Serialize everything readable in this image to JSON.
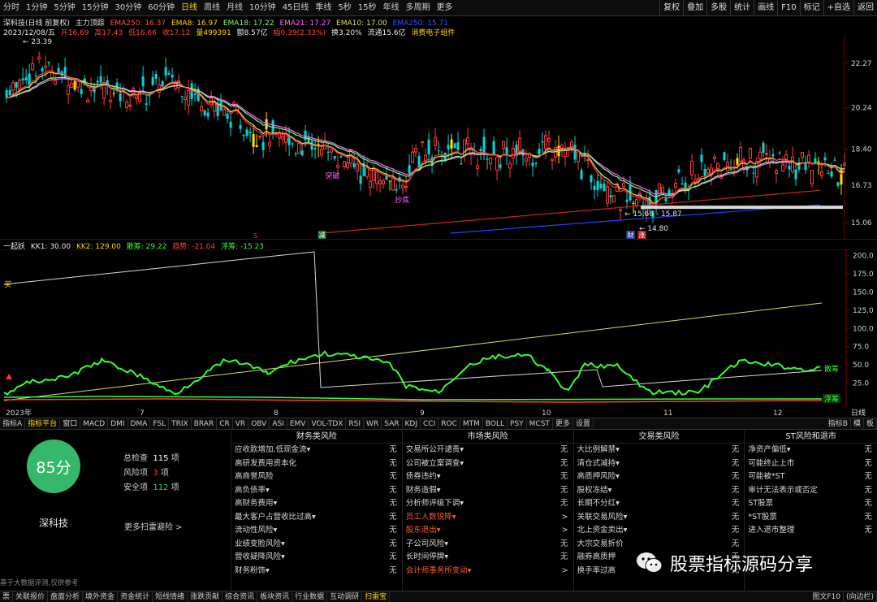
{
  "toolbar": {
    "periods": [
      "分时",
      "1分钟",
      "5分钟",
      "15分钟",
      "30分钟",
      "60分钟",
      "日线",
      "周线",
      "月线",
      "10分钟",
      "45日线",
      "季线",
      "5秒",
      "15秒",
      "年线",
      "多周期",
      "更多"
    ],
    "active_period": "日线",
    "right_buttons": [
      "复权",
      "叠加",
      "多股",
      "统计",
      "画线",
      "F10",
      "标记",
      "+自选",
      "返回"
    ]
  },
  "header": {
    "stock_name": "深科技(日线 前复权)",
    "indicator": "主力顶踪",
    "ema250": "EMA250: 16.37",
    "ema8": "EMA8: 16.97",
    "ema18": "EMA18: 17.22",
    "ema21": "EMA21: 17.27",
    "ema10": "EMA10: 17.00",
    "ema_hidden": "EMA250: 15.71",
    "date": "2023/12/08/五",
    "open": "开16.69",
    "high": "高17.43",
    "low": "低16.66",
    "close": "收17.12",
    "volume": "量499391",
    "amount": "额8.57亿",
    "change": "幅0.39(2.33%)",
    "turnover": "换3.20%",
    "float_cap": "流通15.6亿",
    "concept": "消费电子组件"
  },
  "price_axis": [
    "22.27",
    "20.24",
    "18.40",
    "16.73",
    "15.06"
  ],
  "price_marks": {
    "high": "23.39",
    "low": "14.80",
    "range": "15.66 - 15.87",
    "signal_buy": "抄底",
    "signal_break": "突破",
    "tag_reduce": "减",
    "tag_cai": "财",
    "tag_zhang": "涨",
    "tag_s": "S"
  },
  "indicator_header": {
    "name": "一起妖",
    "kk1": "KK1: 30.00",
    "kk2": "KK2: 129.00",
    "sanhu": "散筹: 29.22",
    "trend": "趋势: -21.04",
    "float": "浮筹: -15.23"
  },
  "indicator_axis": [
    "200.0",
    "175.0",
    "150.0",
    "125.0",
    "100.0",
    "75.0",
    "50.0",
    "25.0"
  ],
  "indicator_tags": {
    "buy": "买",
    "sanhu": "散筹",
    "float": "浮筹"
  },
  "time_axis": [
    "2023年",
    "7",
    "8",
    "9",
    "10",
    "11",
    "12"
  ],
  "time_axis_right": "日线",
  "tabs": [
    "指标A",
    "指标平台",
    "窗口",
    "MACD",
    "DMI",
    "DMA",
    "FSL",
    "TRIX",
    "BRAR",
    "CR",
    "VR",
    "OBV",
    "ASI",
    "EMV",
    "VOL-TDX",
    "RSI",
    "WR",
    "SAR",
    "KDJ",
    "CCI",
    "ROC",
    "MTM",
    "BOLL",
    "PSY",
    "MCST",
    "更多",
    "设置"
  ],
  "active_tab": "指标平台",
  "tabs_right": [
    "指标B",
    "模",
    "板"
  ],
  "risk": {
    "score": "85分",
    "stock": "深科技",
    "total_label": "总检查",
    "total_value": "115",
    "risk_label": "风险项",
    "risk_value": "3",
    "safe_label": "安全项",
    "safe_value": "112",
    "unit": "项",
    "more": "更多扫雷避险 >",
    "disclaimer": "基于大数据评测,仅供参考"
  },
  "columns": [
    {
      "title": "财务类风险",
      "rows": [
        {
          "label": "应收款增加,低现金流▾",
          "value": "无",
          "alert": false
        },
        {
          "label": "高研发费用资本化",
          "value": "无",
          "alert": false
        },
        {
          "label": "高商誉风险",
          "value": "无",
          "alert": false
        },
        {
          "label": "高负债率▾",
          "value": "无",
          "alert": false
        },
        {
          "label": "高财务费用▾",
          "value": "无",
          "alert": false
        },
        {
          "label": "最大客户占营收比过高▾",
          "value": "无",
          "alert": false
        },
        {
          "label": "流动性风险▾",
          "value": "无",
          "alert": false
        },
        {
          "label": "业绩变脸风险▾",
          "value": "无",
          "alert": false
        },
        {
          "label": "营收疑降风险▾",
          "value": "无",
          "alert": false
        },
        {
          "label": "财务粉饰▾",
          "value": "无",
          "alert": false
        }
      ]
    },
    {
      "title": "市场类风险",
      "rows": [
        {
          "label": "交易所公开谴责▾",
          "value": "无",
          "alert": false
        },
        {
          "label": "公司被立案调查▾",
          "value": "无",
          "alert": false
        },
        {
          "label": "债券违约▾",
          "value": "无",
          "alert": false
        },
        {
          "label": "财务造假▾",
          "value": "无",
          "alert": false
        },
        {
          "label": "分析师评级下调▾",
          "value": "无",
          "alert": false
        },
        {
          "label": "员工人数锐降▾",
          "value": ">",
          "alert": true
        },
        {
          "label": "股东退出▾",
          "value": ">",
          "alert": true
        },
        {
          "label": "子公司风险▾",
          "value": "无",
          "alert": false
        },
        {
          "label": "长时间停牌▾",
          "value": "无",
          "alert": false
        },
        {
          "label": "会计师事务所变动▾",
          "value": ">",
          "alert": true
        }
      ]
    },
    {
      "title": "交易类风险",
      "rows": [
        {
          "label": "大比例解禁▾",
          "value": "无",
          "alert": false
        },
        {
          "label": "清仓式减持▾",
          "value": "无",
          "alert": false
        },
        {
          "label": "高质押风险▾",
          "value": "无",
          "alert": false
        },
        {
          "label": "股权冻结▾",
          "value": "无",
          "alert": false
        },
        {
          "label": "长期不分红▾",
          "value": "无",
          "alert": false
        },
        {
          "label": "关联交易风险▾",
          "value": "无",
          "alert": false
        },
        {
          "label": "北上资金卖出▾",
          "value": "无",
          "alert": false
        },
        {
          "label": "大宗交易折价",
          "value": "无",
          "alert": false
        },
        {
          "label": "融券高质押",
          "value": "无",
          "alert": false
        },
        {
          "label": "换手率过高",
          "value": "无",
          "alert": false
        }
      ]
    },
    {
      "title": "ST风险和退市",
      "rows": [
        {
          "label": "净资产偏低▾",
          "value": "无",
          "alert": false
        },
        {
          "label": "可能终止上市",
          "value": "无",
          "alert": false
        },
        {
          "label": "可能被*ST",
          "value": "无",
          "alert": false
        },
        {
          "label": "审计无法表示或否定",
          "value": "无",
          "alert": false
        },
        {
          "label": "ST股票",
          "value": "无",
          "alert": false
        },
        {
          "label": "*ST股票",
          "value": "无",
          "alert": false
        },
        {
          "label": "进入退市整理",
          "value": "无",
          "alert": false
        }
      ]
    }
  ],
  "watermark": "股票指标源码分享",
  "bottom_tabs": [
    "票",
    "关联报价",
    "盘面分析",
    "境外资金",
    "资金统计",
    "短线情绪",
    "涨跌贡献",
    "综合资讯",
    "板块资讯",
    "行业数据",
    "互动调研",
    "扫雷宝"
  ],
  "active_bottom_tab": "扫雷宝",
  "bottom_right": [
    "图文F10",
    "(向边栏)"
  ],
  "colors": {
    "up": "#ff3c3c",
    "down": "#00d8d8",
    "gold": "#ffe000",
    "green": "#33ff33",
    "white": "#e0e0e0",
    "score_bg": "#35b86a"
  }
}
